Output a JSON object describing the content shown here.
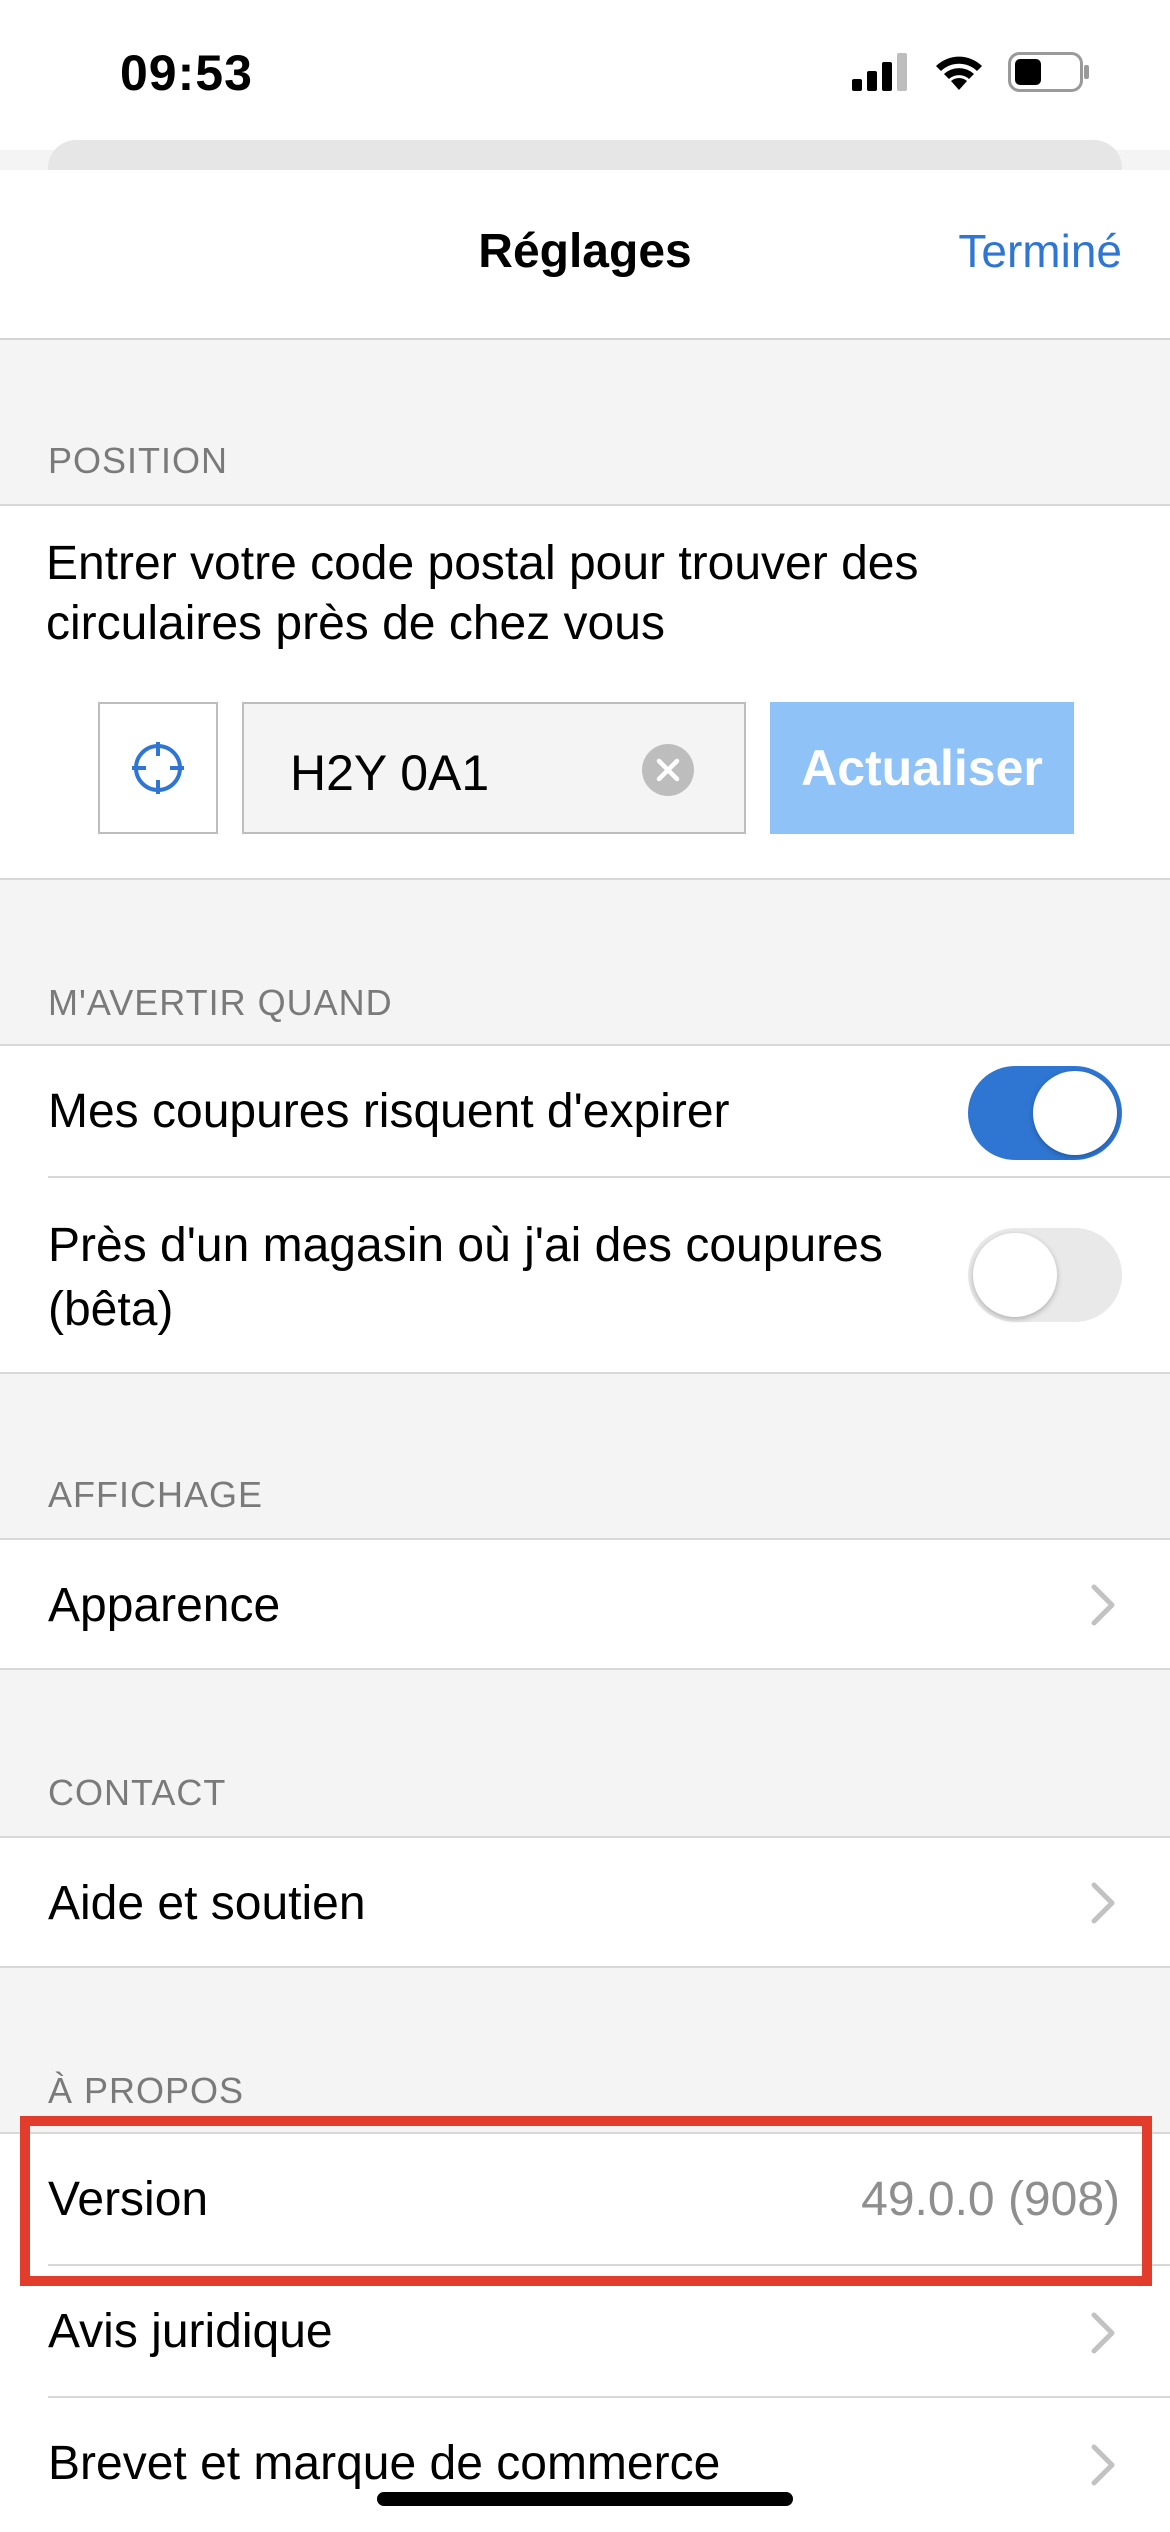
{
  "status_bar": {
    "time": "09:53"
  },
  "nav": {
    "title": "Réglages",
    "done_label": "Terminé"
  },
  "position": {
    "header": "POSITION",
    "description": "Entrer votre code postal pour trouver des circulaires près de chez vous",
    "postal_code": "H2Y 0A1",
    "refresh_label": "Actualiser"
  },
  "notify": {
    "header": "M'AVERTIR QUAND",
    "items": [
      {
        "label": "Mes coupures risquent d'expirer",
        "enabled": true
      },
      {
        "label": "Près d'un magasin où j'ai des coupures (bêta)",
        "enabled": false
      }
    ]
  },
  "display": {
    "header": "AFFICHAGE",
    "appearance_label": "Apparence"
  },
  "contact": {
    "header": "CONTACT",
    "help_label": "Aide et soutien"
  },
  "about": {
    "header": "À PROPOS",
    "version_label": "Version",
    "version_value": "49.0.0 (908)",
    "legal_label": "Avis juridique",
    "patent_label": "Brevet et marque de commerce"
  },
  "colors": {
    "accent": "#2f76d2",
    "refresh_button": "#8fc3f7",
    "highlight": "#e23d2c"
  }
}
